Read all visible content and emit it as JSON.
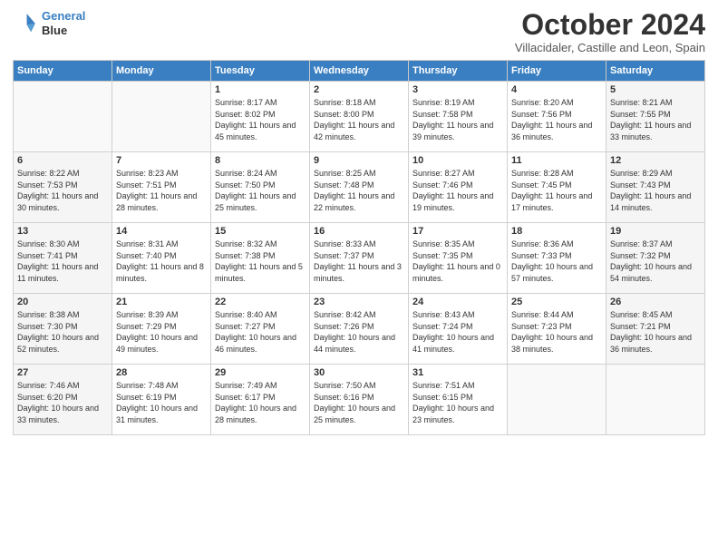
{
  "header": {
    "logo_line1": "General",
    "logo_line2": "Blue",
    "month": "October 2024",
    "location": "Villacidaler, Castille and Leon, Spain"
  },
  "days_of_week": [
    "Sunday",
    "Monday",
    "Tuesday",
    "Wednesday",
    "Thursday",
    "Friday",
    "Saturday"
  ],
  "weeks": [
    [
      {
        "day": "",
        "info": ""
      },
      {
        "day": "",
        "info": ""
      },
      {
        "day": "1",
        "info": "Sunrise: 8:17 AM\nSunset: 8:02 PM\nDaylight: 11 hours and 45 minutes."
      },
      {
        "day": "2",
        "info": "Sunrise: 8:18 AM\nSunset: 8:00 PM\nDaylight: 11 hours and 42 minutes."
      },
      {
        "day": "3",
        "info": "Sunrise: 8:19 AM\nSunset: 7:58 PM\nDaylight: 11 hours and 39 minutes."
      },
      {
        "day": "4",
        "info": "Sunrise: 8:20 AM\nSunset: 7:56 PM\nDaylight: 11 hours and 36 minutes."
      },
      {
        "day": "5",
        "info": "Sunrise: 8:21 AM\nSunset: 7:55 PM\nDaylight: 11 hours and 33 minutes."
      }
    ],
    [
      {
        "day": "6",
        "info": "Sunrise: 8:22 AM\nSunset: 7:53 PM\nDaylight: 11 hours and 30 minutes."
      },
      {
        "day": "7",
        "info": "Sunrise: 8:23 AM\nSunset: 7:51 PM\nDaylight: 11 hours and 28 minutes."
      },
      {
        "day": "8",
        "info": "Sunrise: 8:24 AM\nSunset: 7:50 PM\nDaylight: 11 hours and 25 minutes."
      },
      {
        "day": "9",
        "info": "Sunrise: 8:25 AM\nSunset: 7:48 PM\nDaylight: 11 hours and 22 minutes."
      },
      {
        "day": "10",
        "info": "Sunrise: 8:27 AM\nSunset: 7:46 PM\nDaylight: 11 hours and 19 minutes."
      },
      {
        "day": "11",
        "info": "Sunrise: 8:28 AM\nSunset: 7:45 PM\nDaylight: 11 hours and 17 minutes."
      },
      {
        "day": "12",
        "info": "Sunrise: 8:29 AM\nSunset: 7:43 PM\nDaylight: 11 hours and 14 minutes."
      }
    ],
    [
      {
        "day": "13",
        "info": "Sunrise: 8:30 AM\nSunset: 7:41 PM\nDaylight: 11 hours and 11 minutes."
      },
      {
        "day": "14",
        "info": "Sunrise: 8:31 AM\nSunset: 7:40 PM\nDaylight: 11 hours and 8 minutes."
      },
      {
        "day": "15",
        "info": "Sunrise: 8:32 AM\nSunset: 7:38 PM\nDaylight: 11 hours and 5 minutes."
      },
      {
        "day": "16",
        "info": "Sunrise: 8:33 AM\nSunset: 7:37 PM\nDaylight: 11 hours and 3 minutes."
      },
      {
        "day": "17",
        "info": "Sunrise: 8:35 AM\nSunset: 7:35 PM\nDaylight: 11 hours and 0 minutes."
      },
      {
        "day": "18",
        "info": "Sunrise: 8:36 AM\nSunset: 7:33 PM\nDaylight: 10 hours and 57 minutes."
      },
      {
        "day": "19",
        "info": "Sunrise: 8:37 AM\nSunset: 7:32 PM\nDaylight: 10 hours and 54 minutes."
      }
    ],
    [
      {
        "day": "20",
        "info": "Sunrise: 8:38 AM\nSunset: 7:30 PM\nDaylight: 10 hours and 52 minutes."
      },
      {
        "day": "21",
        "info": "Sunrise: 8:39 AM\nSunset: 7:29 PM\nDaylight: 10 hours and 49 minutes."
      },
      {
        "day": "22",
        "info": "Sunrise: 8:40 AM\nSunset: 7:27 PM\nDaylight: 10 hours and 46 minutes."
      },
      {
        "day": "23",
        "info": "Sunrise: 8:42 AM\nSunset: 7:26 PM\nDaylight: 10 hours and 44 minutes."
      },
      {
        "day": "24",
        "info": "Sunrise: 8:43 AM\nSunset: 7:24 PM\nDaylight: 10 hours and 41 minutes."
      },
      {
        "day": "25",
        "info": "Sunrise: 8:44 AM\nSunset: 7:23 PM\nDaylight: 10 hours and 38 minutes."
      },
      {
        "day": "26",
        "info": "Sunrise: 8:45 AM\nSunset: 7:21 PM\nDaylight: 10 hours and 36 minutes."
      }
    ],
    [
      {
        "day": "27",
        "info": "Sunrise: 7:46 AM\nSunset: 6:20 PM\nDaylight: 10 hours and 33 minutes."
      },
      {
        "day": "28",
        "info": "Sunrise: 7:48 AM\nSunset: 6:19 PM\nDaylight: 10 hours and 31 minutes."
      },
      {
        "day": "29",
        "info": "Sunrise: 7:49 AM\nSunset: 6:17 PM\nDaylight: 10 hours and 28 minutes."
      },
      {
        "day": "30",
        "info": "Sunrise: 7:50 AM\nSunset: 6:16 PM\nDaylight: 10 hours and 25 minutes."
      },
      {
        "day": "31",
        "info": "Sunrise: 7:51 AM\nSunset: 6:15 PM\nDaylight: 10 hours and 23 minutes."
      },
      {
        "day": "",
        "info": ""
      },
      {
        "day": "",
        "info": ""
      }
    ]
  ]
}
